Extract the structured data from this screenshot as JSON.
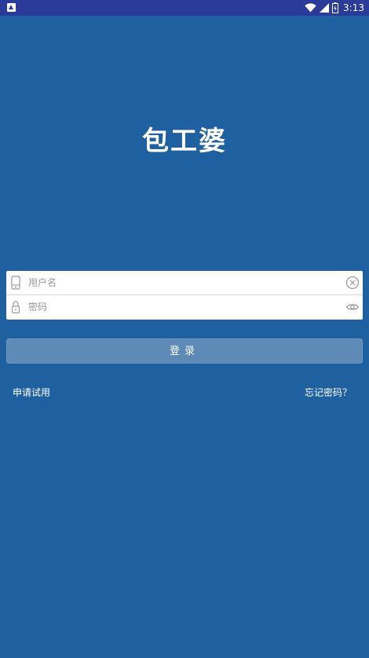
{
  "status_bar": {
    "time": "3:13",
    "notification_icon": "android-notification-icon",
    "wifi_icon": "wifi-icon",
    "signal_icon": "cell-signal-icon",
    "battery_icon": "battery-charging-icon"
  },
  "app": {
    "logo_text": "包工婆"
  },
  "login_form": {
    "username": {
      "placeholder": "用户名",
      "value": "",
      "icon": "phone-icon",
      "action_icon": "clear-circle-icon"
    },
    "password": {
      "placeholder": "密码",
      "value": "",
      "icon": "lock-icon",
      "action_icon": "eye-icon"
    },
    "submit_label": "登录"
  },
  "links": {
    "apply_trial": "申请试用",
    "forgot_password": "忘记密码？"
  },
  "colors": {
    "background": "#1f60a0",
    "status_bar": "#2a3b9a",
    "button": "#5d8ab7",
    "card": "#ffffff"
  }
}
